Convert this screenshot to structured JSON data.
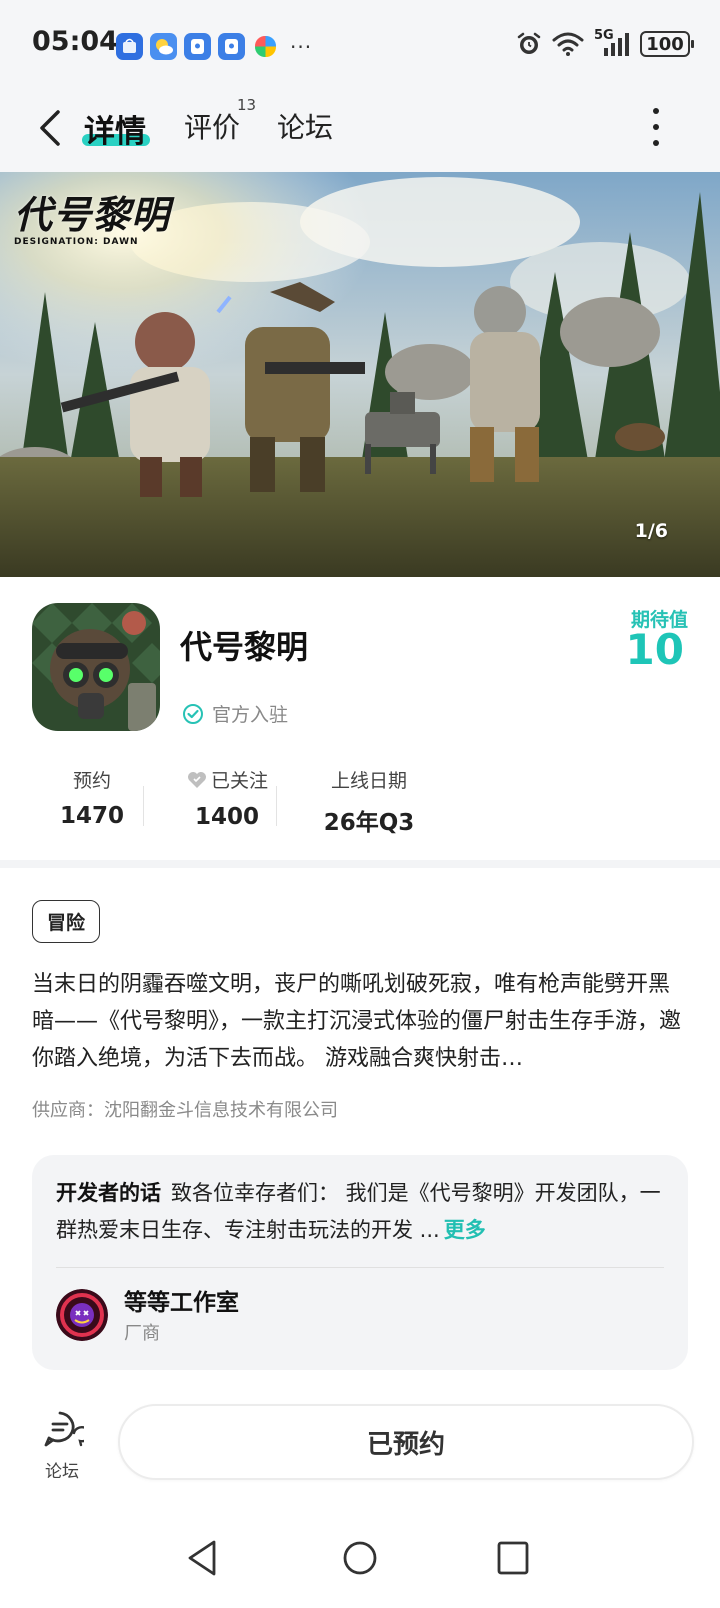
{
  "status_bar": {
    "time": "05:04",
    "battery": "100",
    "network": "5G",
    "more": "···",
    "apps": [
      "app-market-icon",
      "weather-icon",
      "app-lock-icon",
      "app-lock-icon",
      "pinwheel-icon"
    ]
  },
  "nav": {
    "tabs": [
      {
        "label": "详情",
        "active": true
      },
      {
        "label": "评价",
        "badge": "13"
      },
      {
        "label": "论坛"
      }
    ],
    "accent_color": "#2ad1c3"
  },
  "banner": {
    "logo_title": "代号黎明",
    "logo_subtitle": "DESIGNATION: DAWN",
    "counter": "1/6"
  },
  "game": {
    "title": "代号黎明",
    "official_label": "官方入驻",
    "expect_label": "期待值",
    "expect_value": "10",
    "stats": [
      {
        "label": "预约",
        "value": "1470"
      },
      {
        "label": "已关注",
        "value": "1400"
      },
      {
        "label": "上线日期",
        "value": "26年Q3"
      }
    ],
    "tag": "冒险",
    "description": "当末日的阴霾吞噬文明，丧尸的嘶吼划破死寂，唯有枪声能劈开黑暗——《代号黎明》，一款主打沉浸式体验的僵尸射击生存手游，邀你踏入绝境，为活下去而战。 游戏融合爽快射击…",
    "supplier": "供应商：沈阳翻金斗信息技术有限公司"
  },
  "developer": {
    "label": "开发者的话",
    "text": "致各位幸存者们： 我们是《代号黎明》开发团队，一群热爱末日生存、专注射击玩法的开发 ...",
    "more": "更多",
    "studio_name": "等等工作室",
    "studio_role": "厂商"
  },
  "bottom": {
    "forum_label": "论坛",
    "reserve_label": "已预约"
  }
}
